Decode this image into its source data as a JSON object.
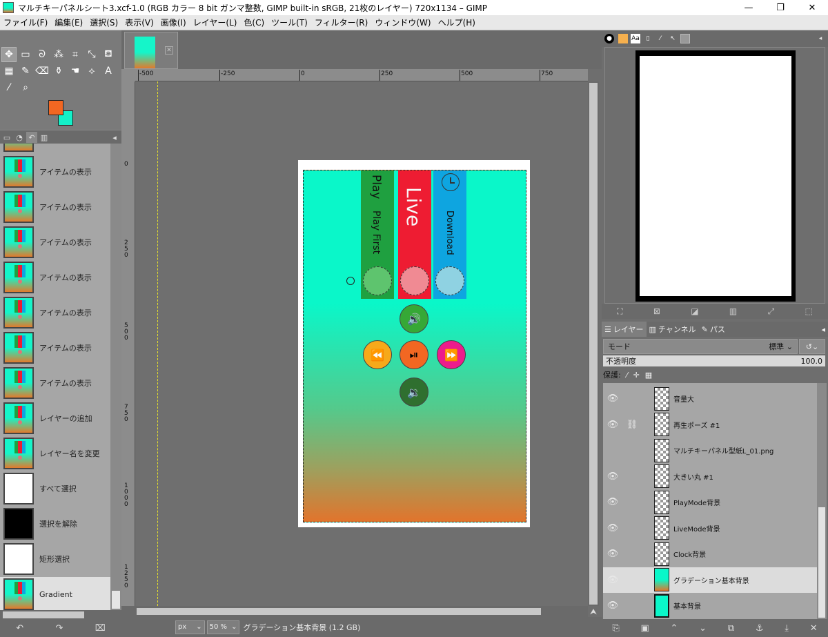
{
  "window": {
    "title": "マルチキーパネルシート3.xcf-1.0 (RGB カラー 8 bit ガンマ整数, GIMP built-in sRGB, 21枚のレイヤー) 720x1134 – GIMP",
    "minimize": "—",
    "restore": "❐",
    "close": "✕"
  },
  "menu": [
    "ファイル(F)",
    "編集(E)",
    "選択(S)",
    "表示(V)",
    "画像(I)",
    "レイヤー(L)",
    "色(C)",
    "ツール(T)",
    "フィルター(R)",
    "ウィンドウ(W)",
    "ヘルプ(H)"
  ],
  "colors": {
    "foreground": "#f26722",
    "background": "#14f0c8"
  },
  "history": [
    {
      "label": "アイテムの表示",
      "thumb": "grad"
    },
    {
      "label": "アイテムの表示",
      "thumb": "grad"
    },
    {
      "label": "アイテムの表示",
      "thumb": "grad"
    },
    {
      "label": "アイテムの表示",
      "thumb": "grad"
    },
    {
      "label": "アイテムの表示",
      "thumb": "grad"
    },
    {
      "label": "アイテムの表示",
      "thumb": "grad"
    },
    {
      "label": "アイテムの表示",
      "thumb": "grad"
    },
    {
      "label": "レイヤーの追加",
      "thumb": "grad"
    },
    {
      "label": "レイヤー名を変更",
      "thumb": "grad"
    },
    {
      "label": "すべて選択",
      "thumb": "white"
    },
    {
      "label": "選択を解除",
      "thumb": "black"
    },
    {
      "label": "矩形選択",
      "thumb": "white"
    },
    {
      "label": "Gradient",
      "thumb": "grad",
      "selected": true
    }
  ],
  "ruler": {
    "top_labels": [
      "-500",
      "-250",
      "0",
      "250",
      "500",
      "750"
    ],
    "left_labels": [
      "0",
      "250",
      "500",
      "750",
      "1000",
      "1250"
    ]
  },
  "image": {
    "panels": {
      "play": {
        "title": "Play",
        "subtitle": "Play First",
        "color": "#1fa040",
        "circle": "#5ec46e"
      },
      "live": {
        "title": "Live",
        "color": "#ee1c32",
        "circle": "#f08a93"
      },
      "download": {
        "title": "Download",
        "color": "#0ea5e0",
        "circle": "#8fd2e2"
      }
    },
    "controls": {
      "vol_up": {
        "icon": "speaker-loud",
        "glyph": "🔊",
        "color": "#36a836"
      },
      "rewind": {
        "icon": "rewind",
        "glyph": "⏪",
        "color": "#f6a91a"
      },
      "play_pause": {
        "icon": "play-pause",
        "glyph": "⏯",
        "color": "#f26722"
      },
      "forward": {
        "icon": "fast-forward",
        "glyph": "⏩",
        "color": "#ec1c8c"
      },
      "vol_down": {
        "icon": "speaker-quiet",
        "glyph": "🔉",
        "color": "#2f6f2f"
      }
    }
  },
  "status": {
    "unit": "px",
    "zoom": "50 %",
    "info": "グラデーション基本背景 (1.2 GB)"
  },
  "layers_panel": {
    "tabs": [
      "レイヤー",
      "チャンネル",
      "パス"
    ],
    "mode_label": "モード",
    "mode_value": "標準",
    "opacity_label": "不透明度",
    "opacity_value": "100.0",
    "lock_label": "保護:",
    "layers": [
      {
        "name": "音量大",
        "visible": true
      },
      {
        "name": "再生ポーズ #1",
        "visible": true,
        "linked": true
      },
      {
        "name": "マルチキーパネル型紙L_01.png",
        "visible": false
      },
      {
        "name": "大きい丸 #1",
        "visible": true
      },
      {
        "name": "PlayMode背景",
        "visible": true
      },
      {
        "name": "LiveMode背景",
        "visible": true
      },
      {
        "name": "Clock背景",
        "visible": true
      },
      {
        "name": "グラデーション基本背景",
        "visible": true,
        "selected": true,
        "thumb": "grad"
      },
      {
        "name": "基本背景",
        "visible": true,
        "thumb": "cyan"
      }
    ]
  }
}
